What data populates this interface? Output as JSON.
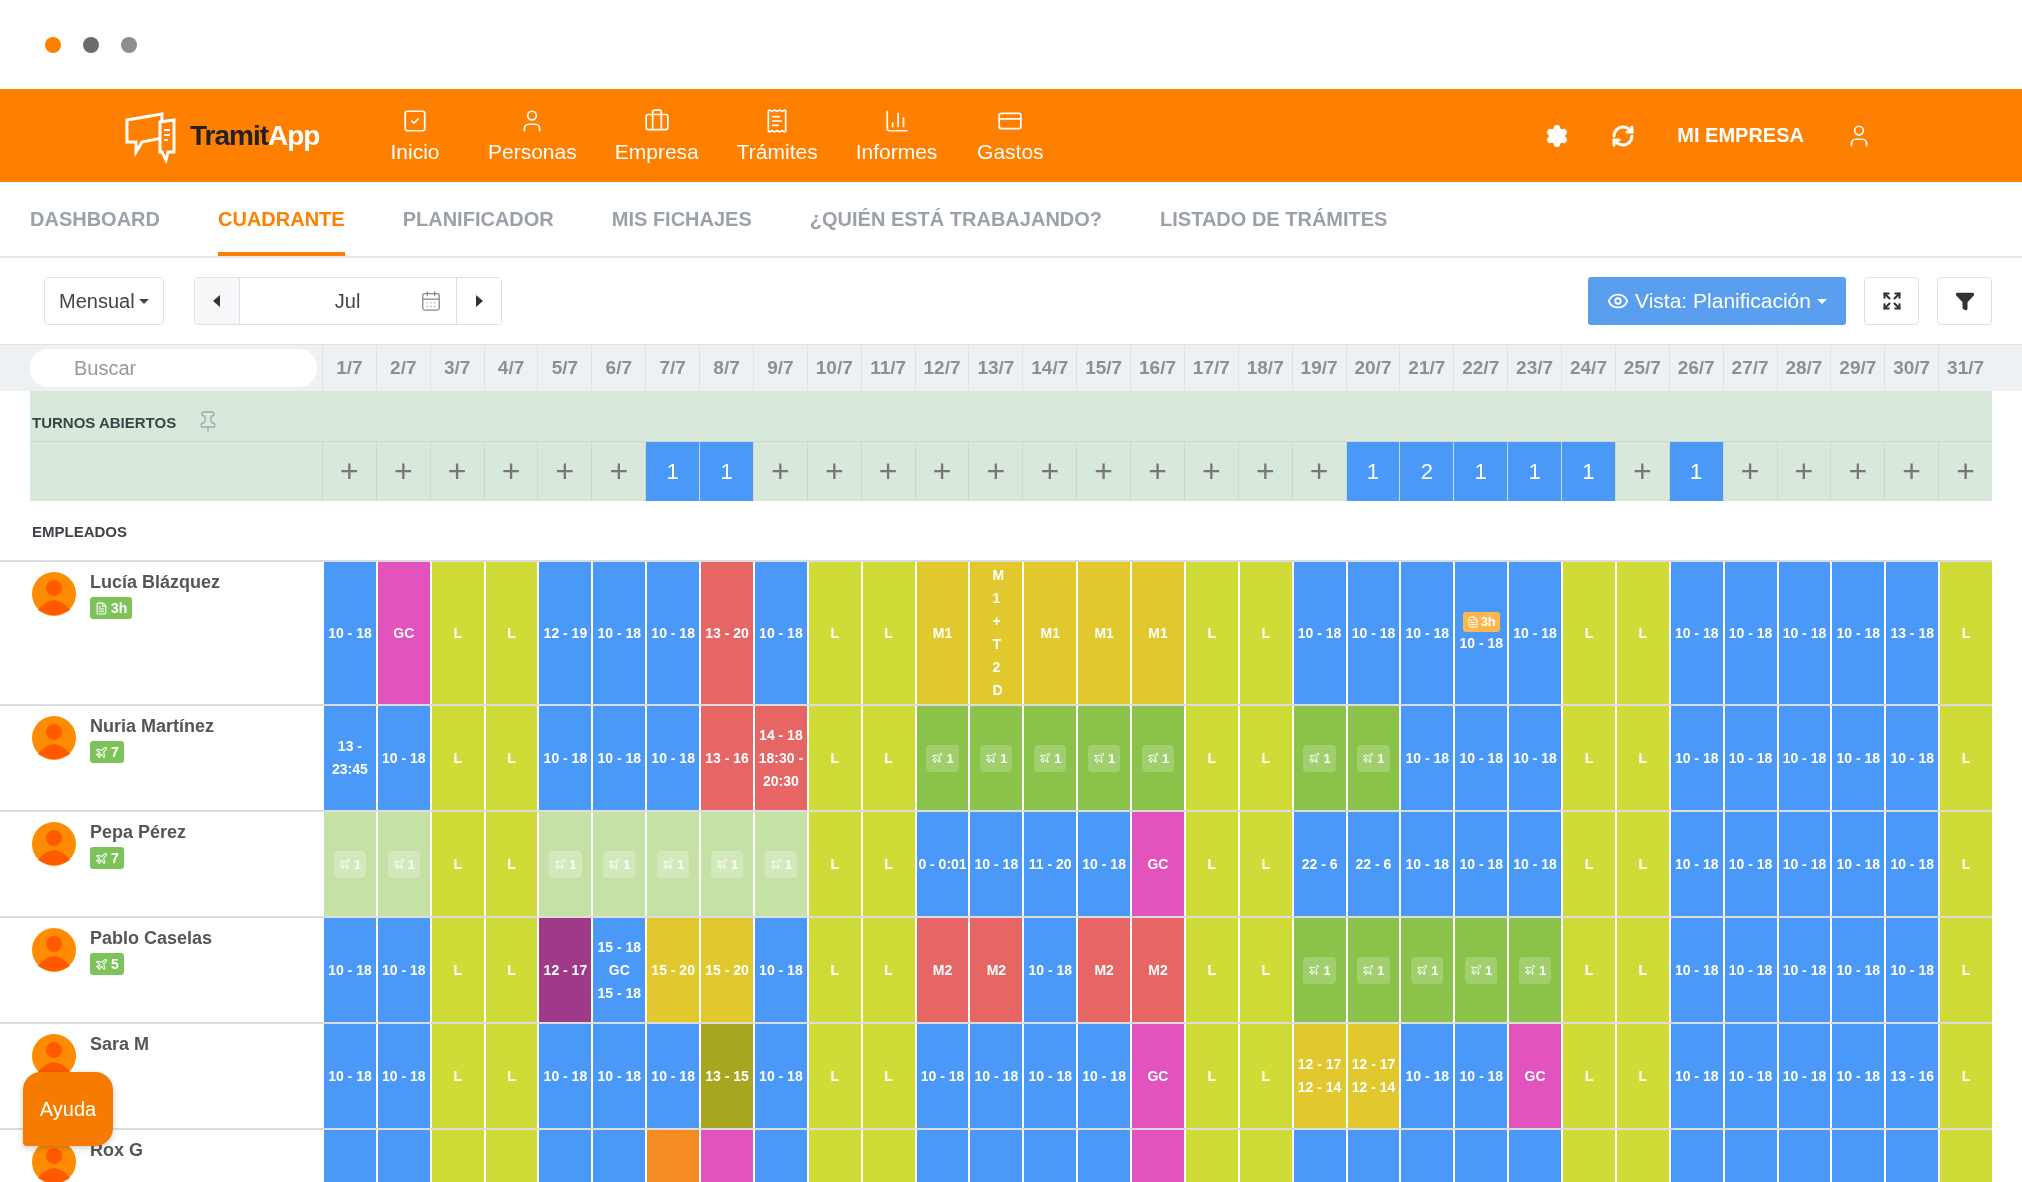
{
  "header": {
    "logo": {
      "first": "Tramit",
      "second": "App"
    },
    "nav": [
      {
        "label": "Inicio"
      },
      {
        "label": "Personas"
      },
      {
        "label": "Empresa"
      },
      {
        "label": "Trámites"
      },
      {
        "label": "Informes"
      },
      {
        "label": "Gastos"
      }
    ],
    "company": "MI EMPRESA"
  },
  "tabs": [
    {
      "label": "DASHBOARD",
      "selected": false
    },
    {
      "label": "CUADRANTE",
      "selected": true
    },
    {
      "label": "PLANIFICADOR",
      "selected": false
    },
    {
      "label": "MIS FICHAJES",
      "selected": false
    },
    {
      "label": "¿QUIÉN ESTÁ TRABAJANDO?",
      "selected": false
    },
    {
      "label": "LISTADO DE TRÁMITES",
      "selected": false
    }
  ],
  "toolbar": {
    "period": "Mensual",
    "month": "Jul",
    "view": "Vista: Planificación"
  },
  "search": {
    "placeholder": "Buscar"
  },
  "dates": [
    "1/7",
    "2/7",
    "3/7",
    "4/7",
    "5/7",
    "6/7",
    "7/7",
    "8/7",
    "9/7",
    "10/7",
    "11/7",
    "12/7",
    "13/7",
    "14/7",
    "15/7",
    "16/7",
    "17/7",
    "18/7",
    "19/7",
    "20/7",
    "21/7",
    "22/7",
    "23/7",
    "24/7",
    "25/7",
    "26/7",
    "27/7",
    "28/7",
    "29/7",
    "30/7",
    "31/7"
  ],
  "open_shifts": {
    "title": "TURNOS ABIERTOS",
    "days": [
      {
        "kind": "add",
        "text": "+"
      },
      {
        "kind": "add",
        "text": "+"
      },
      {
        "kind": "add",
        "text": "+"
      },
      {
        "kind": "add",
        "text": "+"
      },
      {
        "kind": "add",
        "text": "+"
      },
      {
        "kind": "add",
        "text": "+"
      },
      {
        "kind": "count",
        "text": "1"
      },
      {
        "kind": "count",
        "text": "1"
      },
      {
        "kind": "add",
        "text": "+"
      },
      {
        "kind": "add",
        "text": "+"
      },
      {
        "kind": "add",
        "text": "+"
      },
      {
        "kind": "add",
        "text": "+"
      },
      {
        "kind": "add",
        "text": "+"
      },
      {
        "kind": "add",
        "text": "+"
      },
      {
        "kind": "add",
        "text": "+"
      },
      {
        "kind": "add",
        "text": "+"
      },
      {
        "kind": "add",
        "text": "+"
      },
      {
        "kind": "add",
        "text": "+"
      },
      {
        "kind": "add",
        "text": "+"
      },
      {
        "kind": "count",
        "text": "1"
      },
      {
        "kind": "count",
        "text": "2"
      },
      {
        "kind": "count",
        "text": "1"
      },
      {
        "kind": "count",
        "text": "1"
      },
      {
        "kind": "count",
        "text": "1"
      },
      {
        "kind": "add",
        "text": "+"
      },
      {
        "kind": "count",
        "text": "1"
      },
      {
        "kind": "add",
        "text": "+"
      },
      {
        "kind": "add",
        "text": "+"
      },
      {
        "kind": "add",
        "text": "+"
      },
      {
        "kind": "add",
        "text": "+"
      },
      {
        "kind": "add",
        "text": "+"
      }
    ]
  },
  "employees_title": "EMPLEADOS",
  "employees": [
    {
      "name": "Lucía Blázquez",
      "badge": {
        "kind": "document",
        "text": "3h"
      },
      "cells": [
        {
          "kind": "shift",
          "color": "#4a98f7",
          "lines": [
            "10 - 18"
          ]
        },
        {
          "kind": "shift",
          "color": "#e353be",
          "lines": [
            "GC"
          ]
        },
        {
          "kind": "shift",
          "color": "#cfdc37",
          "lines": [
            "L"
          ]
        },
        {
          "kind": "shift",
          "color": "#cfdc37",
          "lines": [
            "L"
          ]
        },
        {
          "kind": "shift",
          "color": "#4a98f7",
          "lines": [
            "12 - 19"
          ]
        },
        {
          "kind": "shift",
          "color": "#4a98f7",
          "lines": [
            "10 - 18"
          ]
        },
        {
          "kind": "shift",
          "color": "#4a98f7",
          "lines": [
            "10 - 18"
          ]
        },
        {
          "kind": "shift",
          "color": "#e66565",
          "lines": [
            "13 - 20"
          ]
        },
        {
          "kind": "shift",
          "color": "#4a98f7",
          "lines": [
            "10 - 18"
          ]
        },
        {
          "kind": "shift",
          "color": "#cfdc37",
          "lines": [
            "L"
          ]
        },
        {
          "kind": "shift",
          "color": "#cfdc37",
          "lines": [
            "L"
          ]
        },
        {
          "kind": "shift",
          "color": "#e0c82e",
          "lines": [
            "M1"
          ]
        },
        {
          "kind": "stacked",
          "color": "#e0c82e",
          "text": "M1+T2D"
        },
        {
          "kind": "shift",
          "color": "#e0c82e",
          "lines": [
            "M1"
          ]
        },
        {
          "kind": "shift",
          "color": "#e0c82e",
          "lines": [
            "M1"
          ]
        },
        {
          "kind": "shift",
          "color": "#e0c82e",
          "lines": [
            "M1"
          ]
        },
        {
          "kind": "shift",
          "color": "#cfdc37",
          "lines": [
            "L"
          ]
        },
        {
          "kind": "shift",
          "color": "#cfdc37",
          "lines": [
            "L"
          ]
        },
        {
          "kind": "shift",
          "color": "#4a98f7",
          "lines": [
            "10 - 18"
          ]
        },
        {
          "kind": "shift",
          "color": "#4a98f7",
          "lines": [
            "10 - 18"
          ]
        },
        {
          "kind": "shift",
          "color": "#4a98f7",
          "lines": [
            "10 - 18"
          ]
        },
        {
          "kind": "shift",
          "color": "#4a98f7",
          "note": "3h",
          "lines": [
            "10 - 18"
          ]
        },
        {
          "kind": "shift",
          "color": "#4a98f7",
          "lines": [
            "10 - 18"
          ]
        },
        {
          "kind": "shift",
          "color": "#cfdc37",
          "lines": [
            "L"
          ]
        },
        {
          "kind": "shift",
          "color": "#cfdc37",
          "lines": [
            "L"
          ]
        },
        {
          "kind": "shift",
          "color": "#4a98f7",
          "lines": [
            "10 - 18"
          ]
        },
        {
          "kind": "shift",
          "color": "#4a98f7",
          "lines": [
            "10 - 18"
          ]
        },
        {
          "kind": "shift",
          "color": "#4a98f7",
          "lines": [
            "10 - 18"
          ]
        },
        {
          "kind": "shift",
          "color": "#4a98f7",
          "lines": [
            "10 - 18"
          ]
        },
        {
          "kind": "shift",
          "color": "#4a98f7",
          "lines": [
            "13 - 18"
          ]
        },
        {
          "kind": "shift",
          "color": "#cfdc37",
          "lines": [
            "L"
          ]
        }
      ]
    },
    {
      "name": "Nuria Martínez",
      "badge": {
        "kind": "vacation",
        "text": "7"
      },
      "cells": [
        {
          "kind": "shift",
          "color": "#4a98f7",
          "lines": [
            "13 -",
            "23:45"
          ]
        },
        {
          "kind": "shift",
          "color": "#4a98f7",
          "lines": [
            "10 - 18"
          ]
        },
        {
          "kind": "shift",
          "color": "#cfdc37",
          "lines": [
            "L"
          ]
        },
        {
          "kind": "shift",
          "color": "#cfdc37",
          "lines": [
            "L"
          ]
        },
        {
          "kind": "shift",
          "color": "#4a98f7",
          "lines": [
            "10 - 18"
          ]
        },
        {
          "kind": "shift",
          "color": "#4a98f7",
          "lines": [
            "10 - 18"
          ]
        },
        {
          "kind": "shift",
          "color": "#4a98f7",
          "lines": [
            "10 - 18"
          ]
        },
        {
          "kind": "shift",
          "color": "#e66565",
          "lines": [
            "13 - 16"
          ]
        },
        {
          "kind": "shift",
          "color": "#e66565",
          "lines": [
            "14 - 18",
            "18:30 -",
            "20:30"
          ]
        },
        {
          "kind": "shift",
          "color": "#cfdc37",
          "lines": [
            "L"
          ]
        },
        {
          "kind": "shift",
          "color": "#cfdc37",
          "lines": [
            "L"
          ]
        },
        {
          "kind": "vacation",
          "color": "#8bc34a",
          "count": "1"
        },
        {
          "kind": "vacation",
          "color": "#8bc34a",
          "count": "1"
        },
        {
          "kind": "vacation",
          "color": "#8bc34a",
          "count": "1"
        },
        {
          "kind": "vacation",
          "color": "#8bc34a",
          "count": "1"
        },
        {
          "kind": "vacation",
          "color": "#8bc34a",
          "count": "1"
        },
        {
          "kind": "shift",
          "color": "#cfdc37",
          "lines": [
            "L"
          ]
        },
        {
          "kind": "shift",
          "color": "#cfdc37",
          "lines": [
            "L"
          ]
        },
        {
          "kind": "vacation",
          "color": "#8bc34a",
          "count": "1"
        },
        {
          "kind": "vacation",
          "color": "#8bc34a",
          "count": "1"
        },
        {
          "kind": "shift",
          "color": "#4a98f7",
          "lines": [
            "10 - 18"
          ]
        },
        {
          "kind": "shift",
          "color": "#4a98f7",
          "lines": [
            "10 - 18"
          ]
        },
        {
          "kind": "shift",
          "color": "#4a98f7",
          "lines": [
            "10 - 18"
          ]
        },
        {
          "kind": "shift",
          "color": "#cfdc37",
          "lines": [
            "L"
          ]
        },
        {
          "kind": "shift",
          "color": "#cfdc37",
          "lines": [
            "L"
          ]
        },
        {
          "kind": "shift",
          "color": "#4a98f7",
          "lines": [
            "10 - 18"
          ]
        },
        {
          "kind": "shift",
          "color": "#4a98f7",
          "lines": [
            "10 - 18"
          ]
        },
        {
          "kind": "shift",
          "color": "#4a98f7",
          "lines": [
            "10 - 18"
          ]
        },
        {
          "kind": "shift",
          "color": "#4a98f7",
          "lines": [
            "10 - 18"
          ]
        },
        {
          "kind": "shift",
          "color": "#4a98f7",
          "lines": [
            "10 - 18"
          ]
        },
        {
          "kind": "shift",
          "color": "#cfdc37",
          "lines": [
            "L"
          ]
        }
      ]
    },
    {
      "name": "Pepa Pérez",
      "badge": {
        "kind": "vacation",
        "text": "7"
      },
      "cells": [
        {
          "kind": "vacation",
          "color": "#c5e1a5",
          "count": "1"
        },
        {
          "kind": "vacation",
          "color": "#c5e1a5",
          "count": "1"
        },
        {
          "kind": "shift",
          "color": "#cfdc37",
          "lines": [
            "L"
          ]
        },
        {
          "kind": "shift",
          "color": "#cfdc37",
          "lines": [
            "L"
          ]
        },
        {
          "kind": "vacation",
          "color": "#c5e1a5",
          "count": "1"
        },
        {
          "kind": "vacation",
          "color": "#c5e1a5",
          "count": "1"
        },
        {
          "kind": "vacation",
          "color": "#c5e1a5",
          "count": "1"
        },
        {
          "kind": "vacation",
          "color": "#c5e1a5",
          "count": "1"
        },
        {
          "kind": "vacation",
          "color": "#c5e1a5",
          "count": "1"
        },
        {
          "kind": "shift",
          "color": "#cfdc37",
          "lines": [
            "L"
          ]
        },
        {
          "kind": "shift",
          "color": "#cfdc37",
          "lines": [
            "L"
          ]
        },
        {
          "kind": "shift",
          "color": "#4a98f7",
          "lines": [
            "0 - 0:01"
          ]
        },
        {
          "kind": "shift",
          "color": "#4a98f7",
          "lines": [
            "10 - 18"
          ]
        },
        {
          "kind": "shift",
          "color": "#4a98f7",
          "lines": [
            "11 - 20"
          ]
        },
        {
          "kind": "shift",
          "color": "#4a98f7",
          "lines": [
            "10 - 18"
          ]
        },
        {
          "kind": "shift",
          "color": "#e353be",
          "lines": [
            "GC"
          ]
        },
        {
          "kind": "shift",
          "color": "#cfdc37",
          "lines": [
            "L"
          ]
        },
        {
          "kind": "shift",
          "color": "#cfdc37",
          "lines": [
            "L"
          ]
        },
        {
          "kind": "shift",
          "color": "#4a98f7",
          "lines": [
            "22 - 6"
          ]
        },
        {
          "kind": "shift",
          "color": "#4a98f7",
          "lines": [
            "22 - 6"
          ]
        },
        {
          "kind": "shift",
          "color": "#4a98f7",
          "lines": [
            "10 - 18"
          ]
        },
        {
          "kind": "shift",
          "color": "#4a98f7",
          "lines": [
            "10 - 18"
          ]
        },
        {
          "kind": "shift",
          "color": "#4a98f7",
          "lines": [
            "10 - 18"
          ]
        },
        {
          "kind": "shift",
          "color": "#cfdc37",
          "lines": [
            "L"
          ]
        },
        {
          "kind": "shift",
          "color": "#cfdc37",
          "lines": [
            "L"
          ]
        },
        {
          "kind": "shift",
          "color": "#4a98f7",
          "lines": [
            "10 - 18"
          ]
        },
        {
          "kind": "shift",
          "color": "#4a98f7",
          "lines": [
            "10 - 18"
          ]
        },
        {
          "kind": "shift",
          "color": "#4a98f7",
          "lines": [
            "10 - 18"
          ]
        },
        {
          "kind": "shift",
          "color": "#4a98f7",
          "lines": [
            "10 - 18"
          ]
        },
        {
          "kind": "shift",
          "color": "#4a98f7",
          "lines": [
            "10 - 18"
          ]
        },
        {
          "kind": "shift",
          "color": "#cfdc37",
          "lines": [
            "L"
          ]
        }
      ]
    },
    {
      "name": "Pablo Caselas",
      "badge": {
        "kind": "vacation",
        "text": "5"
      },
      "cells": [
        {
          "kind": "shift",
          "color": "#4a98f7",
          "lines": [
            "10 - 18"
          ]
        },
        {
          "kind": "shift",
          "color": "#4a98f7",
          "lines": [
            "10 - 18"
          ]
        },
        {
          "kind": "shift",
          "color": "#cfdc37",
          "lines": [
            "L"
          ]
        },
        {
          "kind": "shift",
          "color": "#cfdc37",
          "lines": [
            "L"
          ]
        },
        {
          "kind": "shift",
          "color": "#9e3a87",
          "lines": [
            "12 - 17"
          ]
        },
        {
          "kind": "shift",
          "color": "#4a98f7",
          "lines": [
            "15 - 18",
            "GC",
            "15 - 18"
          ]
        },
        {
          "kind": "shift",
          "color": "#e0c82e",
          "lines": [
            "15 - 20"
          ]
        },
        {
          "kind": "shift",
          "color": "#e0c82e",
          "lines": [
            "15 - 20"
          ]
        },
        {
          "kind": "shift",
          "color": "#4a98f7",
          "lines": [
            "10 - 18"
          ]
        },
        {
          "kind": "shift",
          "color": "#cfdc37",
          "lines": [
            "L"
          ]
        },
        {
          "kind": "shift",
          "color": "#cfdc37",
          "lines": [
            "L"
          ]
        },
        {
          "kind": "shift",
          "color": "#e66565",
          "lines": [
            "M2"
          ]
        },
        {
          "kind": "shift",
          "color": "#e66565",
          "lines": [
            "M2"
          ]
        },
        {
          "kind": "shift",
          "color": "#4a98f7",
          "lines": [
            "10 - 18"
          ]
        },
        {
          "kind": "shift",
          "color": "#e66565",
          "lines": [
            "M2"
          ]
        },
        {
          "kind": "shift",
          "color": "#e66565",
          "lines": [
            "M2"
          ]
        },
        {
          "kind": "shift",
          "color": "#cfdc37",
          "lines": [
            "L"
          ]
        },
        {
          "kind": "shift",
          "color": "#cfdc37",
          "lines": [
            "L"
          ]
        },
        {
          "kind": "vacation",
          "color": "#8bc34a",
          "count": "1"
        },
        {
          "kind": "vacation",
          "color": "#8bc34a",
          "count": "1"
        },
        {
          "kind": "vacation",
          "color": "#8bc34a",
          "count": "1"
        },
        {
          "kind": "vacation",
          "color": "#8bc34a",
          "count": "1"
        },
        {
          "kind": "vacation",
          "color": "#8bc34a",
          "count": "1"
        },
        {
          "kind": "shift",
          "color": "#cfdc37",
          "lines": [
            "L"
          ]
        },
        {
          "kind": "shift",
          "color": "#cfdc37",
          "lines": [
            "L"
          ]
        },
        {
          "kind": "shift",
          "color": "#4a98f7",
          "lines": [
            "10 - 18"
          ]
        },
        {
          "kind": "shift",
          "color": "#4a98f7",
          "lines": [
            "10 - 18"
          ]
        },
        {
          "kind": "shift",
          "color": "#4a98f7",
          "lines": [
            "10 - 18"
          ]
        },
        {
          "kind": "shift",
          "color": "#4a98f7",
          "lines": [
            "10 - 18"
          ]
        },
        {
          "kind": "shift",
          "color": "#4a98f7",
          "lines": [
            "10 - 18"
          ]
        },
        {
          "kind": "shift",
          "color": "#cfdc37",
          "lines": [
            "L"
          ]
        }
      ]
    },
    {
      "name": "Sara M",
      "cells": [
        {
          "kind": "shift",
          "color": "#4a98f7",
          "lines": [
            "10 - 18"
          ]
        },
        {
          "kind": "shift",
          "color": "#4a98f7",
          "lines": [
            "10 - 18"
          ]
        },
        {
          "kind": "shift",
          "color": "#cfdc37",
          "lines": [
            "L"
          ]
        },
        {
          "kind": "shift",
          "color": "#cfdc37",
          "lines": [
            "L"
          ]
        },
        {
          "kind": "shift",
          "color": "#4a98f7",
          "lines": [
            "10 - 18"
          ]
        },
        {
          "kind": "shift",
          "color": "#4a98f7",
          "lines": [
            "10 - 18"
          ]
        },
        {
          "kind": "shift",
          "color": "#4a98f7",
          "lines": [
            "10 - 18"
          ]
        },
        {
          "kind": "shift",
          "color": "#a8a520",
          "lines": [
            "13 - 15"
          ]
        },
        {
          "kind": "shift",
          "color": "#4a98f7",
          "lines": [
            "10 - 18"
          ]
        },
        {
          "kind": "shift",
          "color": "#cfdc37",
          "lines": [
            "L"
          ]
        },
        {
          "kind": "shift",
          "color": "#cfdc37",
          "lines": [
            "L"
          ]
        },
        {
          "kind": "shift",
          "color": "#4a98f7",
          "lines": [
            "10 - 18"
          ]
        },
        {
          "kind": "shift",
          "color": "#4a98f7",
          "lines": [
            "10 - 18"
          ]
        },
        {
          "kind": "shift",
          "color": "#4a98f7",
          "lines": [
            "10 - 18"
          ]
        },
        {
          "kind": "shift",
          "color": "#4a98f7",
          "lines": [
            "10 - 18"
          ]
        },
        {
          "kind": "shift",
          "color": "#e353be",
          "lines": [
            "GC"
          ]
        },
        {
          "kind": "shift",
          "color": "#cfdc37",
          "lines": [
            "L"
          ]
        },
        {
          "kind": "shift",
          "color": "#cfdc37",
          "lines": [
            "L"
          ]
        },
        {
          "kind": "shift",
          "color": "#e0c82e",
          "lines": [
            "12 - 17",
            "12 - 14"
          ]
        },
        {
          "kind": "shift",
          "color": "#e0c82e",
          "lines": [
            "12 - 17",
            "12 - 14"
          ]
        },
        {
          "kind": "shift",
          "color": "#4a98f7",
          "lines": [
            "10 - 18"
          ]
        },
        {
          "kind": "shift",
          "color": "#4a98f7",
          "lines": [
            "10 - 18"
          ]
        },
        {
          "kind": "shift",
          "color": "#e353be",
          "lines": [
            "GC"
          ]
        },
        {
          "kind": "shift",
          "color": "#cfdc37",
          "lines": [
            "L"
          ]
        },
        {
          "kind": "shift",
          "color": "#cfdc37",
          "lines": [
            "L"
          ]
        },
        {
          "kind": "shift",
          "color": "#4a98f7",
          "lines": [
            "10 - 18"
          ]
        },
        {
          "kind": "shift",
          "color": "#4a98f7",
          "lines": [
            "10 - 18"
          ]
        },
        {
          "kind": "shift",
          "color": "#4a98f7",
          "lines": [
            "10 - 18"
          ]
        },
        {
          "kind": "shift",
          "color": "#4a98f7",
          "lines": [
            "10 - 18"
          ]
        },
        {
          "kind": "shift",
          "color": "#4a98f7",
          "lines": [
            "13 - 16"
          ]
        },
        {
          "kind": "shift",
          "color": "#cfdc37",
          "lines": [
            "L"
          ]
        }
      ]
    },
    {
      "name": "Rox G",
      "cells": [
        {
          "kind": "blank",
          "color": "#4a98f7"
        },
        {
          "kind": "blank",
          "color": "#4a98f7"
        },
        {
          "kind": "blank",
          "color": "#cfdc37"
        },
        {
          "kind": "blank",
          "color": "#cfdc37"
        },
        {
          "kind": "blank",
          "color": "#4a98f7"
        },
        {
          "kind": "blank",
          "color": "#4a98f7"
        },
        {
          "kind": "blank",
          "color": "#f28c23"
        },
        {
          "kind": "blank",
          "color": "#e353be"
        },
        {
          "kind": "blank",
          "color": "#4a98f7"
        },
        {
          "kind": "blank",
          "color": "#cfdc37"
        },
        {
          "kind": "blank",
          "color": "#cfdc37"
        },
        {
          "kind": "blank",
          "color": "#4a98f7"
        },
        {
          "kind": "blank",
          "color": "#4a98f7"
        },
        {
          "kind": "blank",
          "color": "#4a98f7"
        },
        {
          "kind": "blank",
          "color": "#4a98f7"
        },
        {
          "kind": "blank",
          "color": "#e353be"
        },
        {
          "kind": "blank",
          "color": "#cfdc37"
        },
        {
          "kind": "blank",
          "color": "#cfdc37"
        },
        {
          "kind": "blank",
          "color": "#4a98f7"
        },
        {
          "kind": "blank",
          "color": "#4a98f7"
        },
        {
          "kind": "blank",
          "color": "#4a98f7"
        },
        {
          "kind": "blank",
          "color": "#4a98f7"
        },
        {
          "kind": "blank",
          "color": "#4a98f7"
        },
        {
          "kind": "blank",
          "color": "#cfdc37"
        },
        {
          "kind": "blank",
          "color": "#cfdc37"
        },
        {
          "kind": "blank",
          "color": "#4a98f7"
        },
        {
          "kind": "blank",
          "color": "#4a98f7"
        },
        {
          "kind": "blank",
          "color": "#4a98f7"
        },
        {
          "kind": "blank",
          "color": "#4a98f7"
        },
        {
          "kind": "blank",
          "color": "#4a98f7"
        },
        {
          "kind": "blank",
          "color": "#cfdc37"
        }
      ]
    }
  ],
  "help": "Ayuda"
}
